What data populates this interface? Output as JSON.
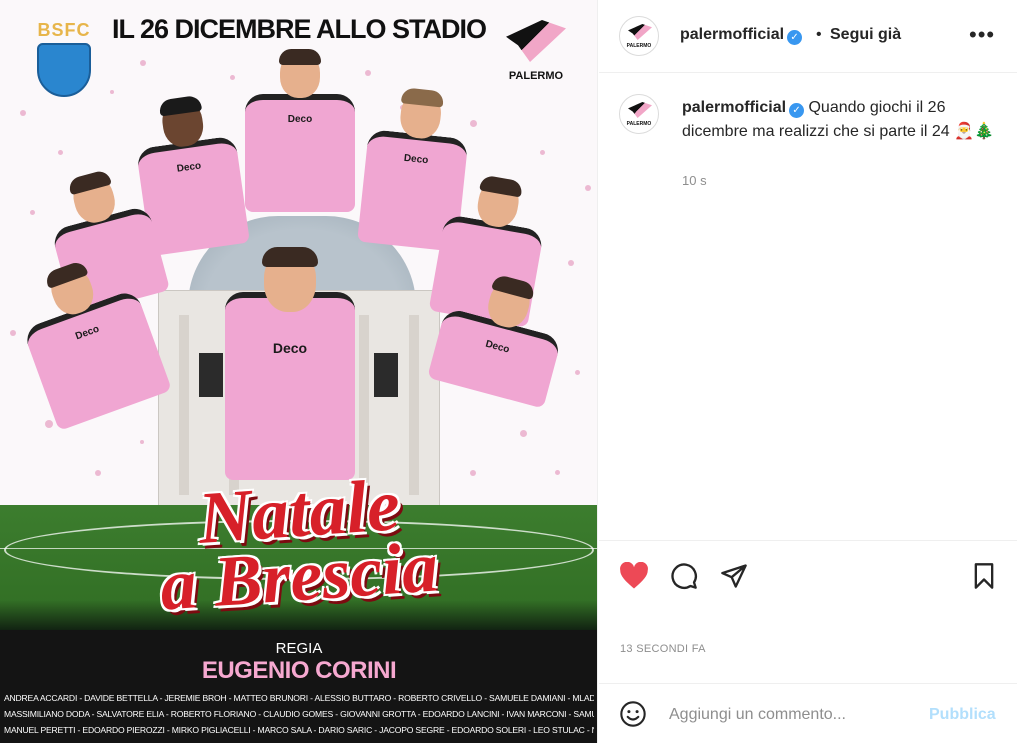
{
  "post": {
    "poster": {
      "headline": "IL 26 DICEMBRE ALLO STADIO",
      "home_logo_text": "BSFC",
      "away_logo_text": "PALERMO",
      "title_line1": "Natale",
      "title_line2": "a Brescia",
      "regia_label": "REGIA",
      "regia_name": "EUGENIO CORINI",
      "player_sponsor": "Deco",
      "credits": [
        "ANDREA ACCARDI - DAVIDE BETTELLA - JEREMIE BROH - MATTEO BRUNORI - ALESSIO BUTTARO - ROBERTO CRIVELLO - SAMUELE DAMIANI - MLADEN DEVETAK - FRANCESCO DI MARIANO",
        "MASSIMILIANO DODA - SALVATORE ELIA - ROBERTO FLORIANO - CLAUDIO GOMES - GIOVANNI GROTTA - EDOARDO LANCINI - IVAN MARCONI - SAMUELE MASSOLO - IONUT NEDELCEARU",
        "MANUEL PERETTI - EDOARDO PIEROZZI - MIRKO PIGLIACELLI - MARCO SALA - DARIO SARIC - JACOPO SEGRE - EDOARDO SOLERI - LEO STULAC - NICOLA VALENTE - LUCA VIDO"
      ]
    },
    "header": {
      "avatar_text": "PALERMO",
      "username": "palermofficial",
      "verified_mark": "✓",
      "separator": "•",
      "follow_label": "Segui già",
      "more_label": "•••"
    },
    "caption": {
      "username": "palermofficial",
      "text": "Quando giochi il 26 dicembre ma realizzi che si parte il 24",
      "emojis": "🎅🎄",
      "age": "10 s"
    },
    "timestamp": "13 SECONDI FA",
    "comment_box": {
      "placeholder": "Aggiungi un commento...",
      "publish_label": "Pubblica"
    },
    "colors": {
      "like_red": "#ed4956",
      "verified_blue": "#3897f0",
      "publish_disabled": "#b2dffc",
      "kit_pink": "#f0a6d2"
    },
    "icons": [
      "heart-icon",
      "comment-icon",
      "share-icon",
      "bookmark-icon",
      "emoji-icon",
      "more-icon",
      "verified-icon"
    ]
  }
}
